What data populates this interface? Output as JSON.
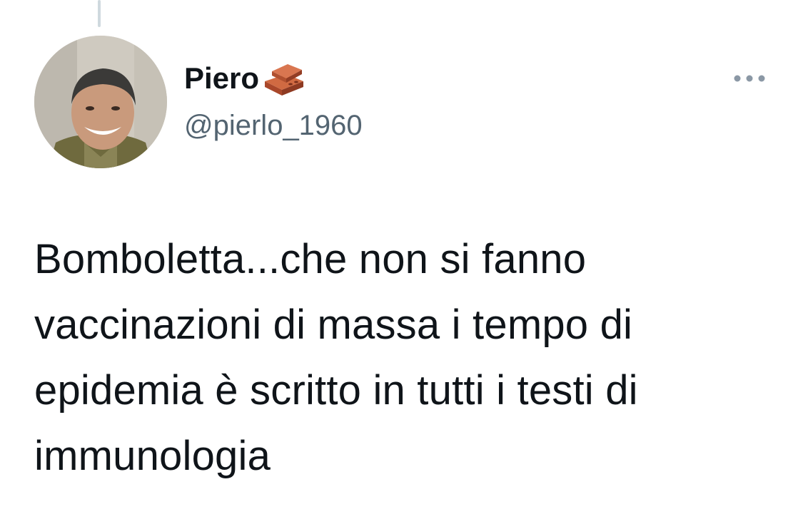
{
  "tweet": {
    "author": {
      "display_name": "Piero",
      "name_emoji_icon": "brick-icon",
      "handle": "@pierlo_1960",
      "avatar_icon": "avatar-photo"
    },
    "more_options_icon": "more-horizontal-icon",
    "text": "Bomboletta...che non si fanno vaccinazioni di massa i tempo di epidemia è scritto in tutti i testi di immunologia"
  },
  "colors": {
    "text_primary": "#0f1419",
    "text_secondary": "#536471",
    "thread_line": "#cfd9de",
    "background": "#ffffff"
  }
}
